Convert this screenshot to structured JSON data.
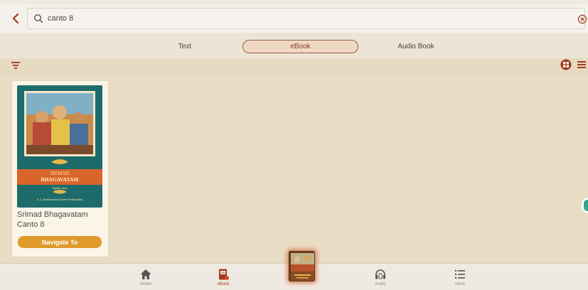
{
  "search": {
    "value": "canto 8"
  },
  "tabs": [
    {
      "label": "Text",
      "active": false
    },
    {
      "label": "eBook",
      "active": true
    },
    {
      "label": "Audio Book",
      "active": false
    }
  ],
  "results": [
    {
      "title": "Srimad Bhagavatam Canto 8",
      "button_label": "Navigate To",
      "cover": {
        "line1": "SRIMAD",
        "line2": "BHAGAVATAM",
        "line3": "Eighth Canto",
        "line4": "A. C. Bhaktivedanta Swami Prabhupāda"
      }
    }
  ],
  "bottom_nav": [
    {
      "label": "Home",
      "icon": "home-icon"
    },
    {
      "label": "eBook",
      "icon": "ebook-icon",
      "active": true
    },
    {
      "label": "Audio",
      "icon": "headphones-icon"
    },
    {
      "label": "More",
      "icon": "list-icon"
    }
  ],
  "colors": {
    "accent": "#a33a1d",
    "button": "#e09a2c",
    "background": "#e8dcc4",
    "cover_teal": "#1e6b6b",
    "cover_orange": "#d9652b"
  }
}
